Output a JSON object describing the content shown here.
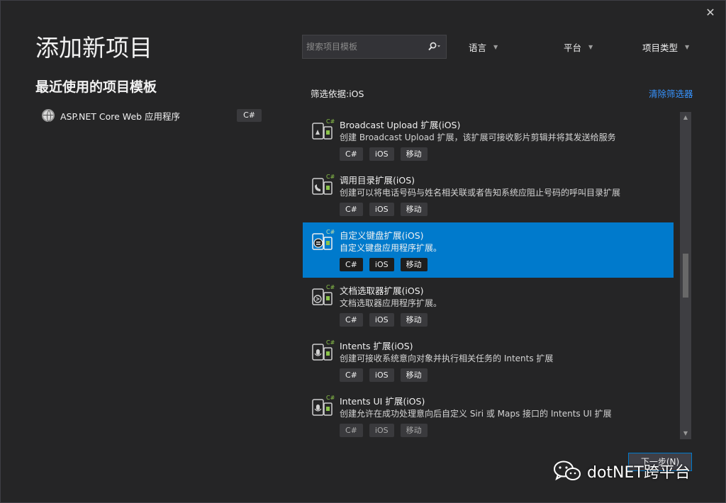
{
  "window": {
    "title": "添加新项目",
    "close_glyph": "✕"
  },
  "recent": {
    "title": "最近使用的项目模板",
    "items": [
      {
        "name": "ASP.NET Core Web 应用程序",
        "icon": "globe-icon",
        "tag": "C#"
      }
    ]
  },
  "search": {
    "placeholder": "搜索项目模板",
    "icon": "search-icon"
  },
  "filters": {
    "language": "语言",
    "platform": "平台",
    "project_type": "项目类型"
  },
  "filter_status": {
    "label": "筛选依据:iOS",
    "clear": "清除筛选器"
  },
  "templates": [
    {
      "name": "Broadcast Upload 扩展(iOS)",
      "desc": "创建 Broadcast Upload 扩展，该扩展可接收影片剪辑并将其发送给服务",
      "tags": [
        "C#",
        "iOS",
        "移动"
      ],
      "selected": false
    },
    {
      "name": "调用目录扩展(iOS)",
      "desc": "创建可以将电话号码与姓名相关联或者告知系统应阻止号码的呼叫目录扩展",
      "tags": [
        "C#",
        "iOS",
        "移动"
      ],
      "selected": false
    },
    {
      "name": "自定义键盘扩展(iOS)",
      "desc": "自定义键盘应用程序扩展。",
      "tags": [
        "C#",
        "iOS",
        "移动"
      ],
      "selected": true
    },
    {
      "name": "文档选取器扩展(iOS)",
      "desc": "文档选取器应用程序扩展。",
      "tags": [
        "C#",
        "iOS",
        "移动"
      ],
      "selected": false
    },
    {
      "name": "Intents 扩展(iOS)",
      "desc": "创建可接收系统意向对象并执行相关任务的 Intents 扩展",
      "tags": [
        "C#",
        "iOS",
        "移动"
      ],
      "selected": false
    },
    {
      "name": "Intents UI 扩展(iOS)",
      "desc": "创建允许在成功处理意向后自定义 Siri 或 Maps 接口的 Intents UI 扩展",
      "tags": [
        "C#",
        "iOS",
        "移动"
      ],
      "selected": false
    }
  ],
  "icon_badge": "C#",
  "footer": {
    "next_label": "下一步(N)"
  },
  "watermark": {
    "text": "dotNET跨平台",
    "icon": "wechat-icon"
  },
  "colors": {
    "background": "#252526",
    "selected": "#007acc",
    "link": "#3794ff",
    "tag_bg": "#3a3a3d"
  }
}
